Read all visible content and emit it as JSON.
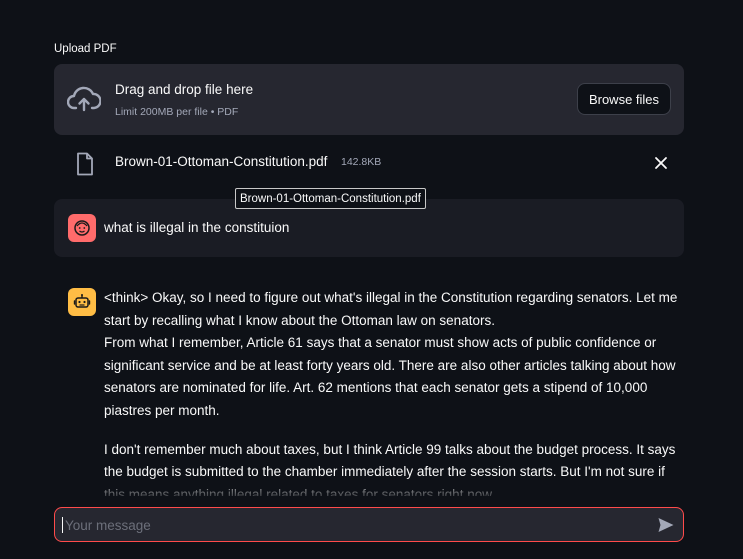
{
  "upload": {
    "label": "Upload PDF",
    "title": "Drag and drop file here",
    "subtitle": "Limit 200MB per file • PDF",
    "browse_label": "Browse files",
    "icon": "cloud-upload-icon"
  },
  "file": {
    "name": "Brown-01-Ottoman-Constitution.pdf",
    "size": "142.8KB",
    "tooltip": "Brown-01-Ottoman-Constitution.pdf"
  },
  "chat": {
    "user_message": "what is illegal in the constituion",
    "assistant_paragraphs": [
      "<think> Okay, so I need to figure out what's illegal in the Constitution regarding senators. Let me start by recalling what I know about the Ottoman law on senators.",
      "From what I remember, Article 61 says that a senator must show acts of public confidence or significant service and be at least forty years old. There are also other articles talking about how senators are nominated for life. Art. 62 mentions that each senator gets a stipend of 10,000 piastres per month.",
      "I don't remember much about taxes, but I think Article 99 talks about the budget process. It says the budget is submitted to the chamber immediately after the session starts. But I'm not sure if this means anything illegal related to taxes for senators right now."
    ],
    "input_placeholder": "Your message"
  },
  "colors": {
    "background": "#0e1117",
    "surface": "#262730",
    "user_avatar": "#ff6b6b",
    "bot_avatar": "#ffbd45",
    "input_border": "#ff4b4b"
  }
}
